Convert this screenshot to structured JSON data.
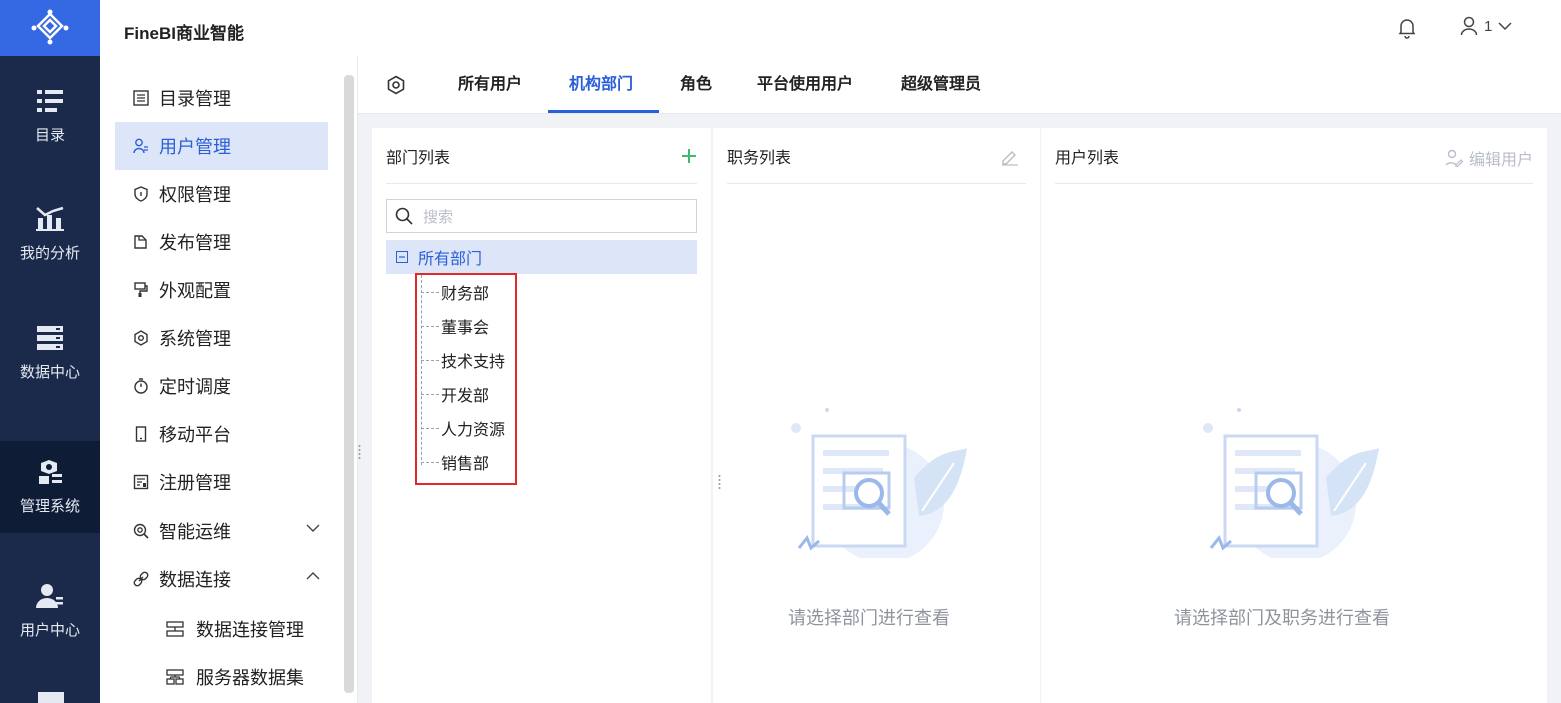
{
  "header": {
    "app_title": "FineBI商业智能",
    "user_name": "1"
  },
  "leftnav": {
    "items": [
      {
        "label": "目录",
        "icon": "catalog-icon"
      },
      {
        "label": "我的分析",
        "icon": "analysis-icon"
      },
      {
        "label": "数据中心",
        "icon": "data-center-icon"
      },
      {
        "label": "管理系统",
        "icon": "management-icon"
      },
      {
        "label": "用户中心",
        "icon": "user-center-icon"
      }
    ],
    "active": "管理系统"
  },
  "menu": {
    "items": [
      {
        "label": "目录管理",
        "icon": "list-icon"
      },
      {
        "label": "用户管理",
        "icon": "user-manage-icon"
      },
      {
        "label": "权限管理",
        "icon": "permission-icon"
      },
      {
        "label": "发布管理",
        "icon": "publish-icon"
      },
      {
        "label": "外观配置",
        "icon": "appearance-icon"
      },
      {
        "label": "系统管理",
        "icon": "system-gear-icon"
      },
      {
        "label": "定时调度",
        "icon": "timer-icon"
      },
      {
        "label": "移动平台",
        "icon": "mobile-icon"
      },
      {
        "label": "注册管理",
        "icon": "register-icon"
      },
      {
        "label": "智能运维",
        "icon": "ops-icon"
      },
      {
        "label": "数据连接",
        "icon": "connection-icon"
      }
    ],
    "sub_items": [
      {
        "label": "数据连接管理",
        "icon": "connection-manage-icon"
      },
      {
        "label": "服务器数据集",
        "icon": "server-dataset-icon"
      }
    ],
    "active": "用户管理"
  },
  "tabs": {
    "items": [
      "所有用户",
      "机构部门",
      "角色",
      "平台使用用户",
      "超级管理员"
    ],
    "active": "机构部门"
  },
  "dept_panel": {
    "title": "部门列表",
    "search_placeholder": "搜索",
    "root": "所有部门",
    "departments": [
      "财务部",
      "董事会",
      "技术支持",
      "开发部",
      "人力资源",
      "销售部"
    ]
  },
  "position_panel": {
    "title": "职务列表",
    "empty_text": "请选择部门进行查看"
  },
  "user_panel": {
    "title": "用户列表",
    "action_label": "编辑用户",
    "empty_text": "请选择部门及职务进行查看"
  },
  "colors": {
    "brand": "#3469e3",
    "nav_bg": "#1b2a4a",
    "accent": "#2b5fd9",
    "highlight_box": "#e0292b"
  }
}
